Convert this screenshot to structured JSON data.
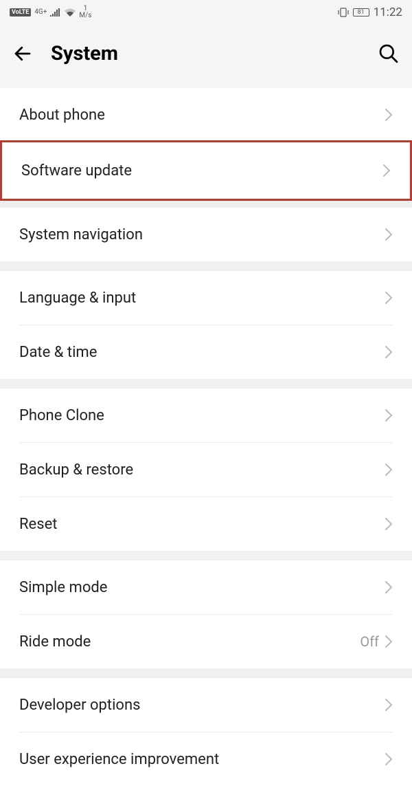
{
  "statusbar": {
    "volte": "VoLTE",
    "network": "4G+",
    "speed_val": "1",
    "speed_unit": "M/s",
    "battery": "81",
    "time": "11:22"
  },
  "header": {
    "title": "System"
  },
  "rows": {
    "about_phone": "About phone",
    "software_update": "Software update",
    "system_navigation": "System navigation",
    "language_input": "Language & input",
    "date_time": "Date & time",
    "phone_clone": "Phone Clone",
    "backup_restore": "Backup & restore",
    "reset": "Reset",
    "simple_mode": "Simple mode",
    "ride_mode": "Ride mode",
    "ride_mode_value": "Off",
    "developer_options": "Developer options",
    "user_experience": "User experience improvement"
  }
}
